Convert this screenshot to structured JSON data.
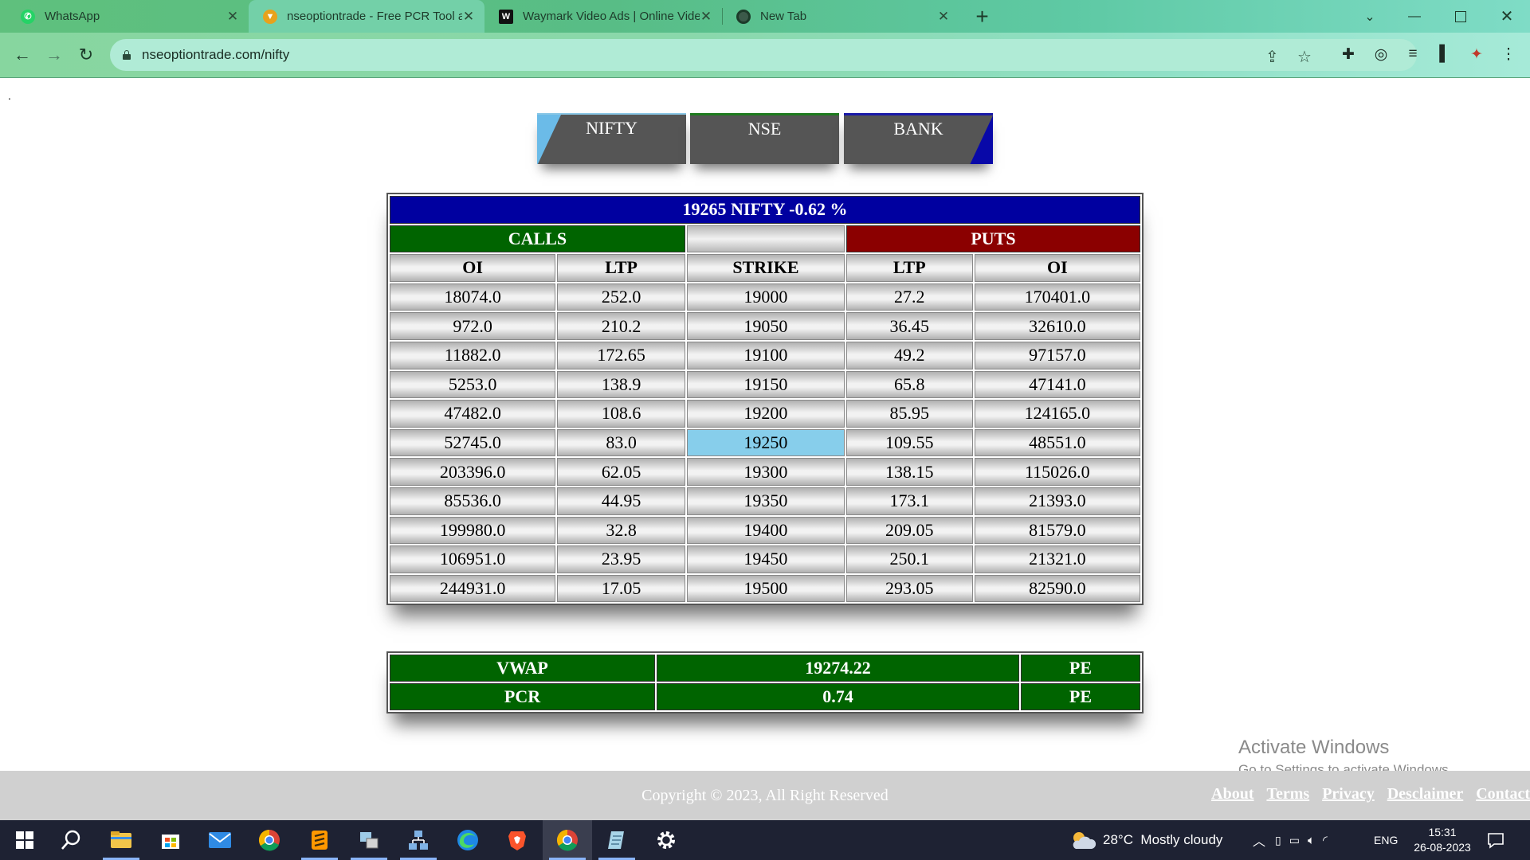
{
  "browser": {
    "tabs": [
      {
        "title": "WhatsApp",
        "icon": "whatsapp-icon",
        "active": false
      },
      {
        "title": "nseoptiontrade - Free PCR Tool a",
        "icon": "site-icon",
        "active": true
      },
      {
        "title": "Waymark Video Ads | Online Vide",
        "icon": "waymark-icon",
        "active": false
      },
      {
        "title": "New Tab",
        "icon": "chrome-icon",
        "active": false
      }
    ],
    "url": "nseoptiontrade.com/nifty"
  },
  "page": {
    "corner_mark": ".",
    "segments": [
      "NIFTY",
      "NSE",
      "BANK"
    ],
    "chain": {
      "title": "19265 NIFTY -0.62 %",
      "calls_label": "CALLS",
      "puts_label": "PUTS",
      "headers": [
        "OI",
        "LTP",
        "STRIKE",
        "LTP",
        "OI"
      ],
      "atm_strike": "19250",
      "atm_color": "#87ceeb",
      "rows": [
        [
          "18074.0",
          "252.0",
          "19000",
          "27.2",
          "170401.0"
        ],
        [
          "972.0",
          "210.2",
          "19050",
          "36.45",
          "32610.0"
        ],
        [
          "11882.0",
          "172.65",
          "19100",
          "49.2",
          "97157.0"
        ],
        [
          "5253.0",
          "138.9",
          "19150",
          "65.8",
          "47141.0"
        ],
        [
          "47482.0",
          "108.6",
          "19200",
          "85.95",
          "124165.0"
        ],
        [
          "52745.0",
          "83.0",
          "19250",
          "109.55",
          "48551.0"
        ],
        [
          "203396.0",
          "62.05",
          "19300",
          "138.15",
          "115026.0"
        ],
        [
          "85536.0",
          "44.95",
          "19350",
          "173.1",
          "21393.0"
        ],
        [
          "199980.0",
          "32.8",
          "19400",
          "209.05",
          "81579.0"
        ],
        [
          "106951.0",
          "23.95",
          "19450",
          "250.1",
          "21321.0"
        ],
        [
          "244931.0",
          "17.05",
          "19500",
          "293.05",
          "82590.0"
        ]
      ]
    },
    "summary": {
      "vwap_label": "VWAP",
      "vwap_value": "19274.22",
      "vwap_side": "PE",
      "pcr_label": "PCR",
      "pcr_value": "0.74",
      "pcr_side": "PE"
    },
    "watermark": {
      "line1": "Activate Windows",
      "line2": "Go to Settings to activate Windows."
    },
    "footer": {
      "copyright": "Copyright © 2023, All Right Reserved",
      "links": [
        "About",
        "Terms",
        "Privacy",
        "Desclaimer",
        "Contact"
      ]
    }
  },
  "taskbar": {
    "weather": "28°C  Mostly cloudy",
    "language": "ENG",
    "time": "15:31",
    "date": "26-08-2023"
  }
}
